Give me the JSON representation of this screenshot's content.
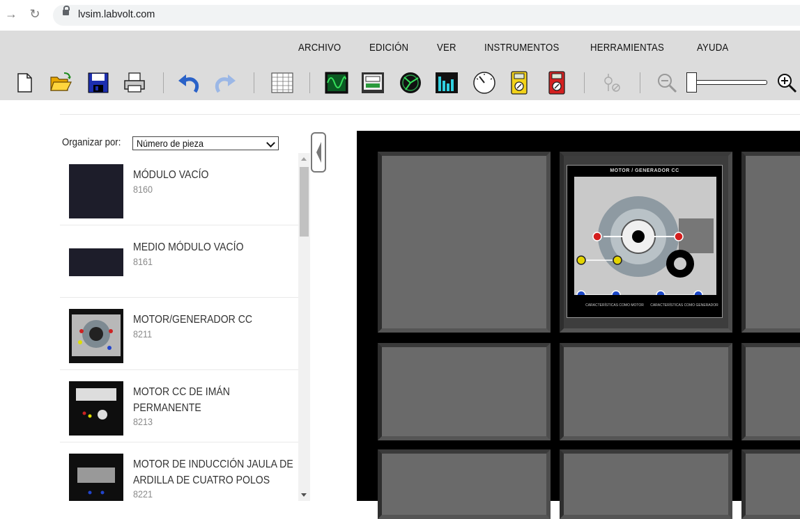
{
  "browser": {
    "url": "lvsim.labvolt.com"
  },
  "menubar": {
    "items": [
      "ARCHIVO",
      "EDICIÓN",
      "VER",
      "INSTRUMENTOS",
      "HERRAMIENTAS",
      "AYUDA"
    ]
  },
  "toolbar": {
    "buttons": [
      "new-file-icon",
      "open-folder-icon",
      "save-icon",
      "print-icon",
      "undo-icon",
      "redo-icon",
      "table-icon",
      "oscilloscope-icon",
      "data-acquisition-icon",
      "phasor-analyzer-icon",
      "harmonic-analyzer-icon",
      "tachometer-icon",
      "yellow-multimeter-icon",
      "red-multimeter-icon",
      "connection-tool-icon",
      "zoom-out-icon",
      "zoom-in-icon"
    ],
    "zoom_slider_level": 0
  },
  "sidebar": {
    "organize_label": "Organizar por:",
    "organize_value": "Número de pieza",
    "parts": [
      {
        "name": "MÓDULO VACÍO",
        "number": "8160"
      },
      {
        "name": "MEDIO MÓDULO VACÍO",
        "number": "8161"
      },
      {
        "name": "MOTOR/GENERADOR CC",
        "number": "8211"
      },
      {
        "name_line1": "MOTOR CC DE IMÁN",
        "name_line2": "PERMANENTE",
        "number": "8213"
      },
      {
        "name_line1": "MOTOR DE INDUCCIÓN JAULA DE",
        "name_line2": "ARDILLA DE CUATRO POLOS",
        "number": "8221"
      }
    ]
  },
  "workspace": {
    "module_title": "MOTOR / GENERADOR CC",
    "module_caption_left": "CARACTERÍSTICAS COMO MOTOR",
    "module_caption_right": "CARACTERÍSTICAS COMO GENERADOR"
  },
  "colors": {
    "menubar_bg": "#dcdcdc",
    "workspace_bg": "#000000",
    "slot_gray": "#6a6a6a"
  }
}
